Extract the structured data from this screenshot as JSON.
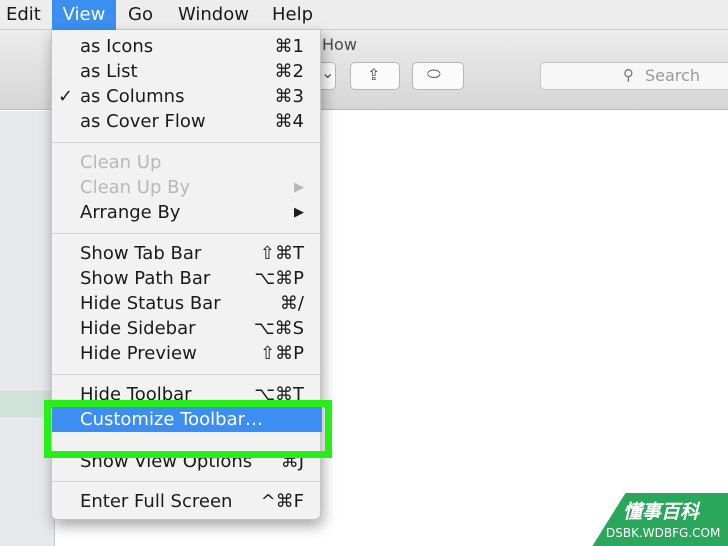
{
  "menubar": {
    "items": [
      "Edit",
      "View",
      "Go",
      "Window",
      "Help"
    ],
    "active": "View"
  },
  "window": {
    "title": "How",
    "search_placeholder": "Search"
  },
  "menu": {
    "groups": [
      [
        {
          "label": "as Icons",
          "shortcut": "⌘1",
          "checked": false,
          "disabled": false
        },
        {
          "label": "as List",
          "shortcut": "⌘2",
          "checked": false,
          "disabled": false
        },
        {
          "label": "as Columns",
          "shortcut": "⌘3",
          "checked": true,
          "disabled": false
        },
        {
          "label": "as Cover Flow",
          "shortcut": "⌘4",
          "checked": false,
          "disabled": false
        }
      ],
      [
        {
          "label": "Clean Up",
          "shortcut": "",
          "disabled": true
        },
        {
          "label": "Clean Up By",
          "submenu": true,
          "disabled": true
        },
        {
          "label": "Arrange By",
          "submenu": true,
          "disabled": false
        }
      ],
      [
        {
          "label": "Show Tab Bar",
          "shortcut": "⇧⌘T",
          "disabled": false
        },
        {
          "label": "Show Path Bar",
          "shortcut": "⌥⌘P",
          "disabled": false
        },
        {
          "label": "Hide Status Bar",
          "shortcut": "⌘/",
          "disabled": false
        },
        {
          "label": "Hide Sidebar",
          "shortcut": "⌥⌘S",
          "disabled": false
        },
        {
          "label": "Hide Preview",
          "shortcut": "⇧⌘P",
          "disabled": false
        }
      ],
      [
        {
          "label": "Hide Toolbar",
          "shortcut": "⌥⌘T",
          "disabled": false
        },
        {
          "label": "Customize Toolbar…",
          "shortcut": "",
          "highlighted": true,
          "disabled": false
        },
        {
          "label": "Show View Options",
          "shortcut": "⌘J",
          "disabled": false
        }
      ],
      [
        {
          "label": "Enter Full Screen",
          "shortcut": "^⌘F",
          "disabled": false
        }
      ]
    ]
  },
  "icons": {
    "check": "✓",
    "submenu_arrow": "▶",
    "search": "⚲",
    "share": "⇪",
    "tag": "⬭",
    "dropdown": "⌄"
  },
  "watermark": {
    "main": "懂事百科",
    "sub": "DSBK.WDBFG.COM"
  },
  "colors": {
    "highlight": "#3d8ef2",
    "callout": "#27ee16",
    "watermark": "#2aa75a"
  }
}
